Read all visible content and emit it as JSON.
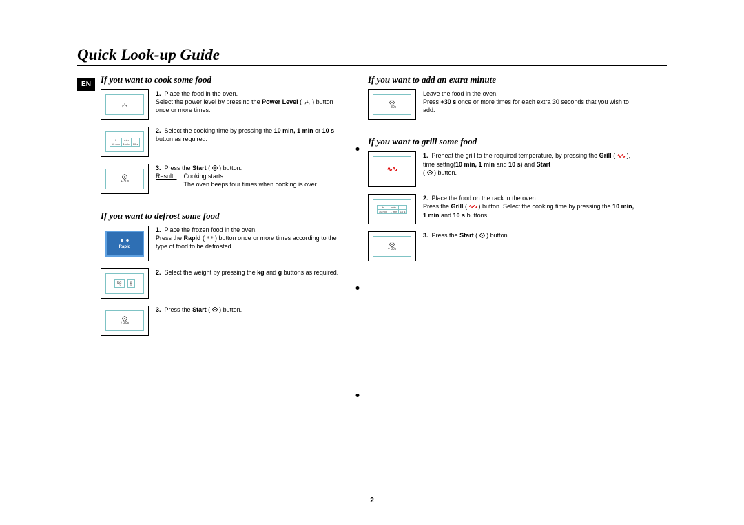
{
  "page_title": "Quick Look-up Guide",
  "lang_tag": "EN",
  "page_number": "2",
  "sec1": {
    "heading": "If you want to cook some food",
    "step1": "Place the food in the oven.",
    "step1b_a": "Select the power level by pressing the ",
    "pl_label": "Power Level",
    "step1b_c": " button once or more times.",
    "step2_a": "Select the cooking time by pressing the ",
    "step2_b": "10 min, 1 min",
    "step2_c": " or ",
    "step2_d": "10 s",
    "step2_e": " button as required.",
    "step3_a": "Press the ",
    "start_label": "Start",
    "step3_c": " button.",
    "result_label": "Result :",
    "result_a": "Cooking starts.",
    "result_b": "The oven beeps four times when cooking is over.",
    "thumb2_h": "h",
    "thumb2_min": "min",
    "thumb2_10min": "10 min",
    "thumb2_1min": "1 min",
    "thumb2_10s": "10 s",
    "thumb3_30s": "+ 30s"
  },
  "sec2": {
    "heading": "If you want to defrost some food",
    "step1": "Place the frozen food in the oven.",
    "step1b_a": "Press the ",
    "rapid_label": "Rapid",
    "step1b_c": " button once or more times according to the type of food to be defrosted.",
    "step2_a": "Select the weight by pressing the ",
    "step2_b": "kg",
    "step2_c": " and ",
    "step2_d": "g",
    "step2_e": " buttons as required.",
    "step3_a": "Press the ",
    "start_label": "Start",
    "step3_c": " button.",
    "thumb1_rapid": "Rapid",
    "thumb_kg": "kg",
    "thumb_g": "g",
    "thumb3_30s": "+ 30s"
  },
  "sec3": {
    "heading": "If you want to add an extra minute",
    "line1": "Leave the food in the oven.",
    "line2_a": "Press ",
    "line2_b": "+30 s",
    "line2_c": " once or more times for each extra 30 seconds that you wish to add.",
    "thumb_30s": "+ 30s"
  },
  "sec4": {
    "heading": "If you want to grill some food",
    "step1_a": "Preheat the grill to the required temperature, by pressing the ",
    "grill_label": "Grill",
    "step1_c": ", time settng(",
    "step1_d": "10 min, 1 min",
    "step1_e": " and ",
    "step1_f": "10 s",
    "step1_g": ") and ",
    "start_label": "Start",
    "step1_i": " button.",
    "step2_a": "Place the food on the rack in the oven.",
    "step2b_a": "Press the ",
    "step2b_c": " button. Select the cooking time by pressing the ",
    "step2b_d": "10 min, 1 min",
    "step2b_e": " and ",
    "step2b_f": "10 s",
    "step2b_g": " buttons.",
    "step3_a": "Press the ",
    "step3_c": " button.",
    "thumb2_h": "h",
    "thumb2_min": "min",
    "thumb2_10min": "10 min",
    "thumb2_1min": "1 min",
    "thumb2_10s": "10 s",
    "thumb3_30s": "+ 30s"
  }
}
